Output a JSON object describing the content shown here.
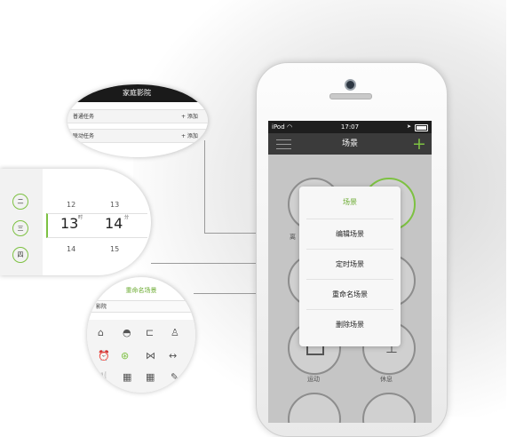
{
  "status_bar": {
    "carrier": "iPod",
    "time": "17:07"
  },
  "nav": {
    "title": "场景"
  },
  "popup": {
    "title": "场景",
    "items": [
      "编辑场景",
      "定时场景",
      "重命名场景",
      "删除场景"
    ]
  },
  "scenes": {
    "partial_label": "离",
    "sport": "运动",
    "rest": "休息"
  },
  "lens_task": {
    "title": "家庭影院",
    "rows": [
      {
        "label": "普通任务",
        "action": "+ 添加"
      },
      {
        "label": "联动任务",
        "action": "+ 添加"
      }
    ]
  },
  "lens_calendar": {
    "weekdays": [
      "二",
      "三",
      "四"
    ],
    "prev_row": [
      "12",
      "13"
    ],
    "dates": [
      "13",
      "14"
    ],
    "superscripts": [
      "时",
      "分"
    ],
    "next_row": [
      "14",
      "15"
    ]
  },
  "lens_rename": {
    "title": "重命名场景",
    "input_value": "影院"
  }
}
